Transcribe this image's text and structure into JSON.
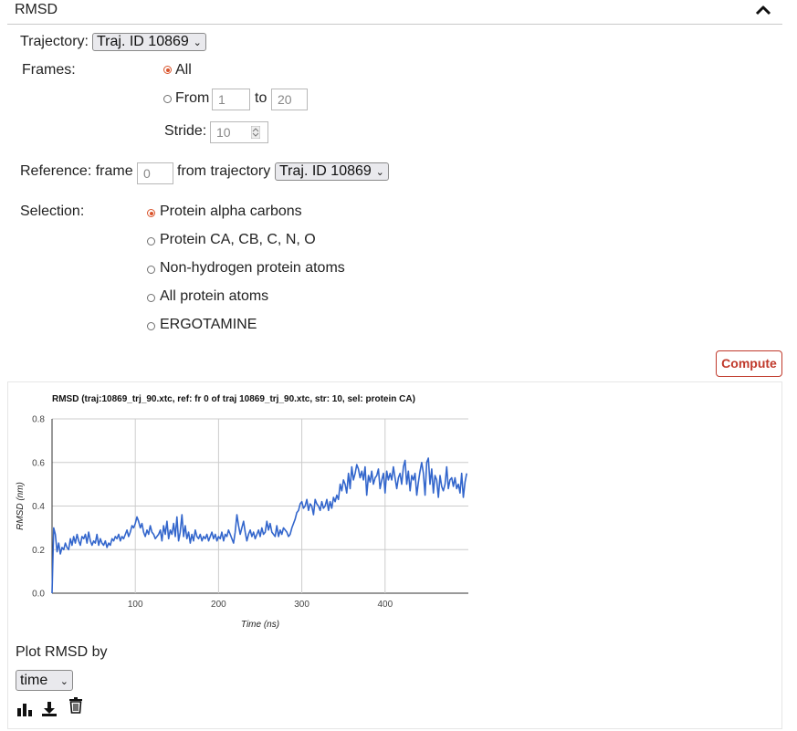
{
  "header": {
    "title": "RMSD",
    "toggle_icon": "chevron-up-icon"
  },
  "trajectory": {
    "label": "Trajectory:",
    "selected": "Traj. ID 10869"
  },
  "frames": {
    "label": "Frames:",
    "all_label": "All",
    "from_label": "From",
    "from_value": "1",
    "to_label": "to",
    "to_value": "20",
    "stride_label": "Stride:",
    "stride_value": "10",
    "selected": "All"
  },
  "reference": {
    "label": "Reference: frame",
    "frame_placeholder": "0",
    "from_traj_label": "from trajectory",
    "selected": "Traj. ID 10869"
  },
  "selection": {
    "label": "Selection:",
    "options": [
      "Protein alpha carbons",
      "Protein CA, CB, C, N, O",
      "Non-hydrogen protein atoms",
      "All protein atoms",
      "ERGOTAMINE"
    ],
    "selected_index": 0
  },
  "compute_label": "Compute",
  "plot_by": {
    "label": "Plot RMSD by",
    "selected": "time"
  },
  "icons": [
    "bar-chart-icon",
    "download-icon",
    "trash-icon"
  ],
  "colors": {
    "accent": "#d9542c",
    "compute": "#c0392b",
    "line": "#3366cc"
  },
  "chart_data": {
    "type": "line",
    "title": "RMSD (traj:10869_trj_90.xtc, ref: fr 0 of traj 10869_trj_90.xtc, str: 10, sel: protein CA)",
    "xlabel": "Time (ns)",
    "ylabel": "RMSD (nm)",
    "xlim": [
      0,
      500
    ],
    "ylim": [
      0,
      0.8
    ],
    "xticks": [
      100,
      200,
      300,
      400
    ],
    "yticks": [
      "0.0",
      "0.2",
      "0.4",
      "0.6",
      "0.8"
    ],
    "grid": true,
    "x": [
      0,
      2,
      4,
      6,
      8,
      10,
      12,
      14,
      16,
      18,
      20,
      22,
      24,
      26,
      28,
      30,
      32,
      34,
      36,
      38,
      40,
      42,
      44,
      46,
      48,
      50,
      52,
      54,
      56,
      58,
      60,
      62,
      64,
      66,
      68,
      70,
      72,
      74,
      76,
      78,
      80,
      82,
      84,
      86,
      88,
      90,
      92,
      94,
      96,
      98,
      100,
      102,
      104,
      106,
      108,
      110,
      112,
      114,
      116,
      118,
      120,
      122,
      124,
      126,
      128,
      130,
      132,
      134,
      136,
      138,
      140,
      142,
      144,
      146,
      148,
      150,
      152,
      154,
      156,
      158,
      160,
      162,
      164,
      166,
      168,
      170,
      172,
      174,
      176,
      178,
      180,
      182,
      184,
      186,
      188,
      190,
      192,
      194,
      196,
      198,
      200,
      202,
      204,
      206,
      208,
      210,
      212,
      214,
      216,
      218,
      220,
      222,
      224,
      226,
      228,
      230,
      232,
      234,
      236,
      238,
      240,
      242,
      244,
      246,
      248,
      250,
      252,
      254,
      256,
      258,
      260,
      262,
      264,
      266,
      268,
      270,
      272,
      274,
      276,
      278,
      280,
      282,
      284,
      286,
      288,
      290,
      292,
      294,
      296,
      298,
      300,
      302,
      304,
      306,
      308,
      310,
      312,
      314,
      316,
      318,
      320,
      322,
      324,
      326,
      328,
      330,
      332,
      334,
      336,
      338,
      340,
      342,
      344,
      346,
      348,
      350,
      352,
      354,
      356,
      358,
      360,
      362,
      364,
      366,
      368,
      370,
      372,
      374,
      376,
      378,
      380,
      382,
      384,
      386,
      388,
      390,
      392,
      394,
      396,
      398,
      400,
      402,
      404,
      406,
      408,
      410,
      412,
      414,
      416,
      418,
      420,
      422,
      424,
      426,
      428,
      430,
      432,
      434,
      436,
      438,
      440,
      442,
      444,
      446,
      448,
      450,
      452,
      454,
      456,
      458,
      460,
      462,
      464,
      466,
      468,
      470,
      472,
      474,
      476,
      478,
      480,
      482,
      484,
      486,
      488,
      490,
      492,
      494,
      496,
      498
    ],
    "series": [
      {
        "values": [
          0.0,
          0.3,
          0.27,
          0.19,
          0.23,
          0.18,
          0.21,
          0.2,
          0.23,
          0.21,
          0.2,
          0.25,
          0.22,
          0.26,
          0.23,
          0.27,
          0.24,
          0.22,
          0.26,
          0.25,
          0.27,
          0.23,
          0.28,
          0.24,
          0.22,
          0.24,
          0.23,
          0.27,
          0.22,
          0.25,
          0.23,
          0.22,
          0.24,
          0.21,
          0.23,
          0.22,
          0.25,
          0.24,
          0.26,
          0.25,
          0.27,
          0.24,
          0.26,
          0.25,
          0.27,
          0.29,
          0.26,
          0.28,
          0.31,
          0.3,
          0.32,
          0.35,
          0.33,
          0.3,
          0.32,
          0.28,
          0.26,
          0.29,
          0.27,
          0.31,
          0.28,
          0.27,
          0.25,
          0.26,
          0.27,
          0.29,
          0.24,
          0.31,
          0.27,
          0.33,
          0.25,
          0.29,
          0.27,
          0.32,
          0.26,
          0.35,
          0.24,
          0.28,
          0.36,
          0.26,
          0.31,
          0.25,
          0.28,
          0.23,
          0.27,
          0.24,
          0.29,
          0.26,
          0.25,
          0.27,
          0.24,
          0.26,
          0.25,
          0.27,
          0.24,
          0.26,
          0.28,
          0.25,
          0.27,
          0.24,
          0.26,
          0.25,
          0.28,
          0.24,
          0.27,
          0.26,
          0.29,
          0.27,
          0.25,
          0.23,
          0.28,
          0.36,
          0.31,
          0.27,
          0.3,
          0.33,
          0.28,
          0.24,
          0.27,
          0.29,
          0.26,
          0.28,
          0.25,
          0.27,
          0.29,
          0.26,
          0.3,
          0.27,
          0.28,
          0.33,
          0.29,
          0.32,
          0.28,
          0.27,
          0.26,
          0.31,
          0.26,
          0.29,
          0.27,
          0.3,
          0.29,
          0.28,
          0.26,
          0.27,
          0.3,
          0.32,
          0.34,
          0.37,
          0.38,
          0.41,
          0.42,
          0.39,
          0.4,
          0.43,
          0.38,
          0.41,
          0.4,
          0.36,
          0.43,
          0.41,
          0.4,
          0.38,
          0.42,
          0.39,
          0.4,
          0.43,
          0.38,
          0.42,
          0.39,
          0.44,
          0.42,
          0.45,
          0.43,
          0.5,
          0.47,
          0.52,
          0.5,
          0.46,
          0.55,
          0.48,
          0.58,
          0.52,
          0.55,
          0.59,
          0.57,
          0.53,
          0.56,
          0.52,
          0.58,
          0.45,
          0.54,
          0.51,
          0.56,
          0.5,
          0.53,
          0.54,
          0.57,
          0.48,
          0.52,
          0.55,
          0.46,
          0.56,
          0.52,
          0.55,
          0.52,
          0.58,
          0.53,
          0.48,
          0.53,
          0.55,
          0.5,
          0.58,
          0.61,
          0.5,
          0.56,
          0.47,
          0.54,
          0.52,
          0.55,
          0.45,
          0.51,
          0.56,
          0.6,
          0.55,
          0.45,
          0.6,
          0.62,
          0.5,
          0.57,
          0.46,
          0.54,
          0.52,
          0.44,
          0.54,
          0.49,
          0.47,
          0.5,
          0.58,
          0.48,
          0.52,
          0.53,
          0.49,
          0.53,
          0.48,
          0.5,
          0.46,
          0.55,
          0.44,
          0.51,
          0.55
        ]
      }
    ]
  }
}
